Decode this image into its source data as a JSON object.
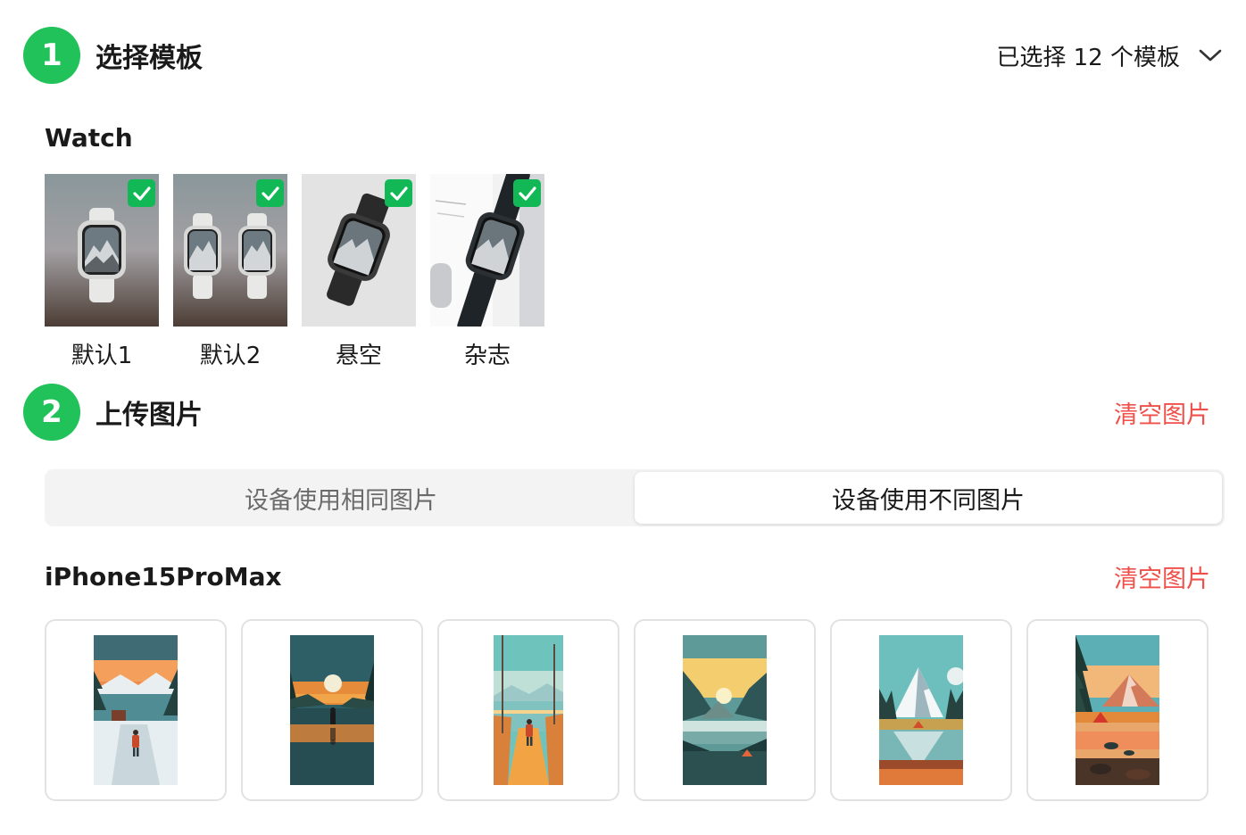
{
  "step1": {
    "number": "1",
    "title": "选择模板",
    "selected_summary": "已选择 12 个模板",
    "dropdown_icon": "chevron-down-icon"
  },
  "watch_group": {
    "title": "Watch",
    "templates": [
      {
        "name": "默认1",
        "checked": true
      },
      {
        "name": "默认2",
        "checked": true
      },
      {
        "name": "悬空",
        "checked": true
      },
      {
        "name": "杂志",
        "checked": true
      }
    ]
  },
  "step2": {
    "number": "2",
    "title": "上传图片",
    "clear_label": "清空图片"
  },
  "mode_toggle": {
    "options": [
      "设备使用相同图片",
      "设备使用不同图片"
    ],
    "active_index": 1
  },
  "device": {
    "name": "iPhone15ProMax",
    "clear_label": "清空图片",
    "images": [
      {
        "scene": "snowy-lake-hiker"
      },
      {
        "scene": "moon-lake-silhouette"
      },
      {
        "scene": "river-path-hiker"
      },
      {
        "scene": "valley-sunset-lake"
      },
      {
        "scene": "snow-peak-reflection"
      },
      {
        "scene": "tent-sunset-lake"
      }
    ]
  },
  "colors": {
    "accent_green": "#22c25a",
    "check_green": "#12b856",
    "danger_red": "#f0504a"
  }
}
